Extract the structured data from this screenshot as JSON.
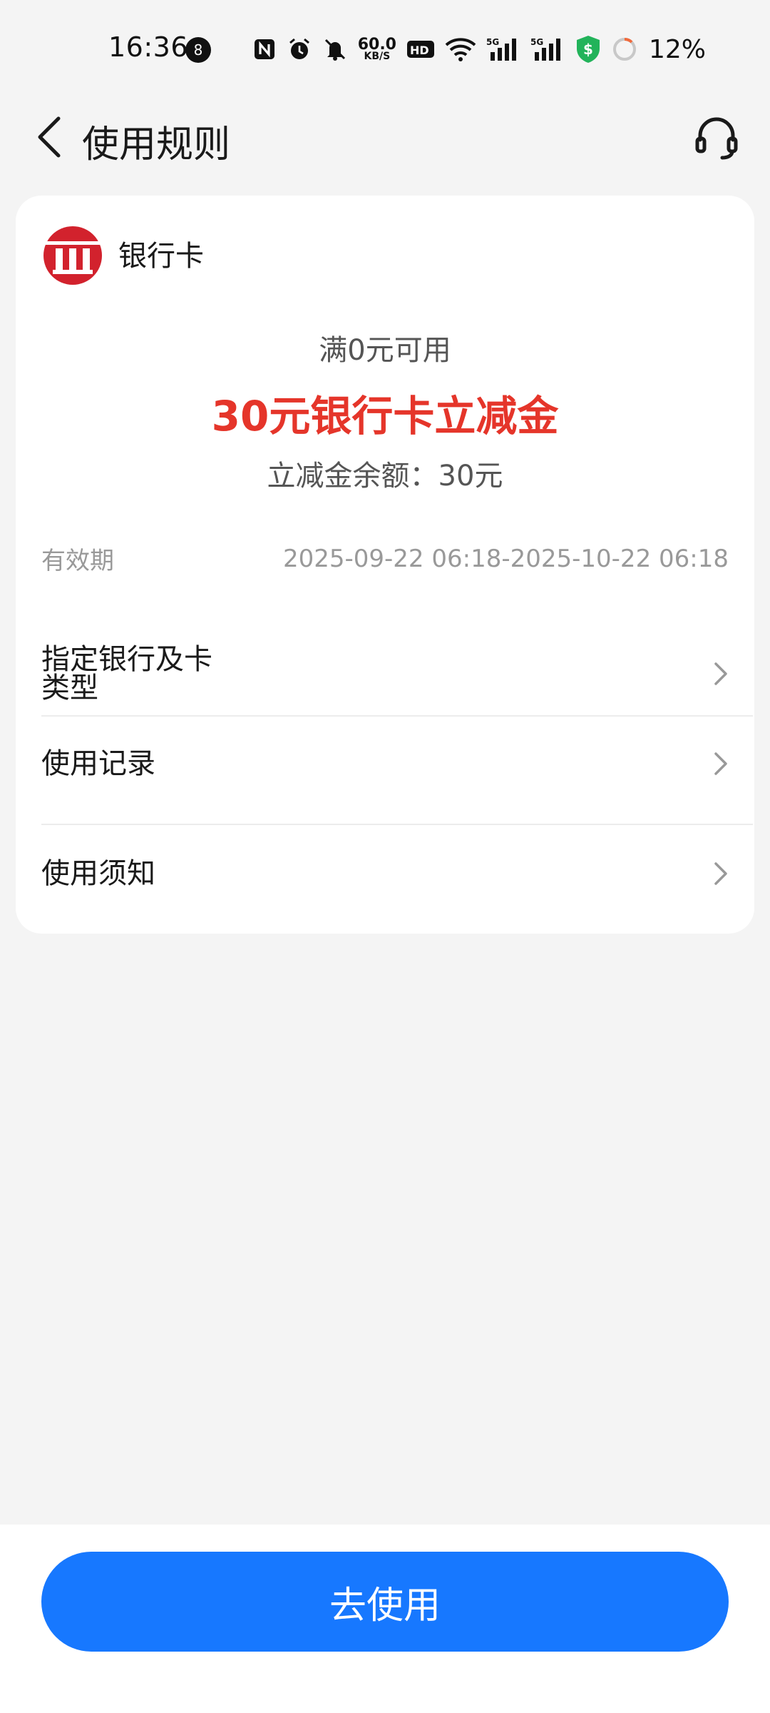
{
  "status_bar": {
    "time": "16:36",
    "notification_count": "8",
    "net_speed": "60.0",
    "net_speed_unit": "KB/S",
    "battery_percent": "12%",
    "icons": [
      "nfc-icon",
      "alarm-icon",
      "mute-icon",
      "netspeed",
      "hd-icon",
      "wifi-icon",
      "signal-5g-icon",
      "signal-5g-icon",
      "security-shield-icon",
      "battery-ring-icon"
    ]
  },
  "header": {
    "title": "使用规则",
    "back_icon": "chevron-left-icon",
    "support_icon": "headset-icon"
  },
  "card": {
    "bank_name": "银行卡",
    "bank_logo_color": "#d2222d",
    "condition": "满0元可用",
    "title": "30元银行卡立减金",
    "title_color": "#e5352a",
    "balance": "立减金余额：30元",
    "validity_label": "有效期",
    "validity_value": "2025-09-22 06:18-2025-10-22 06:18",
    "items": [
      {
        "label": "指定银行及卡类型"
      },
      {
        "label": "使用记录"
      },
      {
        "label": "使用须知"
      }
    ]
  },
  "footer": {
    "use_button": "去使用",
    "button_color": "#1778ff"
  }
}
